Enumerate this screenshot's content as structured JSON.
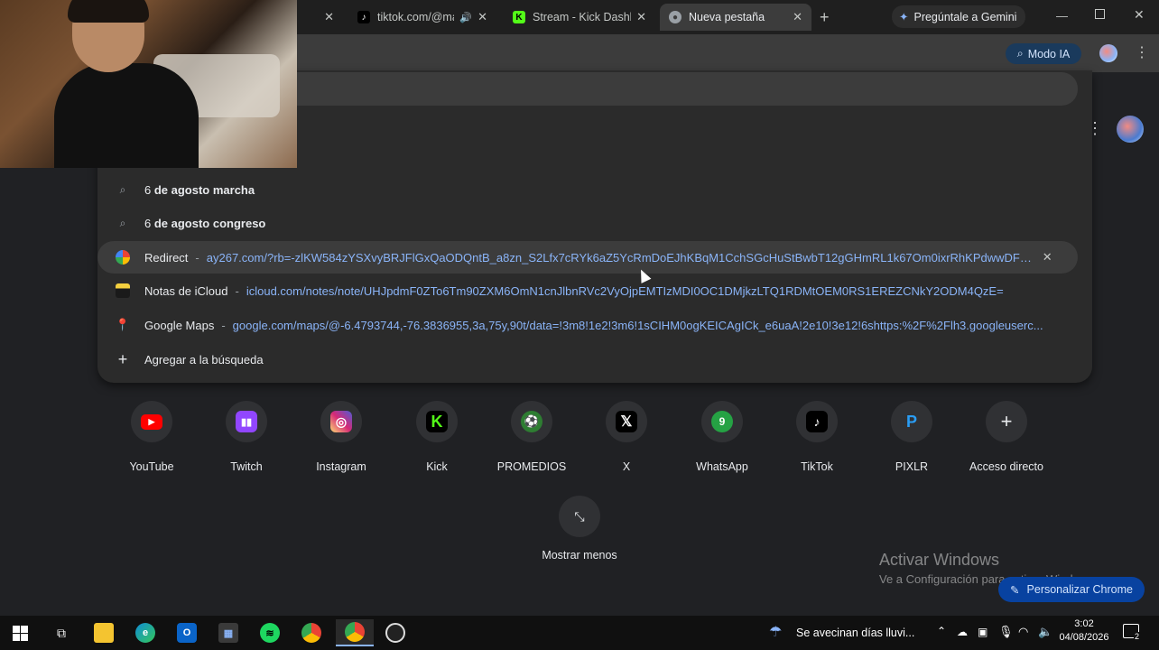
{
  "tabs": [
    {
      "title": "",
      "favicon": "none"
    },
    {
      "title": "tiktok.com/@mar",
      "favicon": "tiktok-icon"
    },
    {
      "title": "Stream - Kick Dashbo",
      "favicon": "kick-icon"
    },
    {
      "title": "Nueva pestaña",
      "favicon": "chrome-icon"
    }
  ],
  "gemini_button": "Pregúntale a Gemini",
  "modo_ia": "Modo IA",
  "suggestions": [
    {
      "icon": "search-icon",
      "text_pre": "6 ",
      "text_bold": "de agosto marcha"
    },
    {
      "icon": "search-icon",
      "text_pre": "6 ",
      "text_bold": "de agosto congreso"
    },
    {
      "icon": "google-icon",
      "title": "Redirect",
      "url": "ay267.com/?rb=-zlKW584zYSXvyBRJFlGxQaODQntB_a8zn_S2Lfx7cRYk6aZ5YcRmDoEJhKBqM1CchSGcHuStBwbT12gGHmRL1k67Om0ixrRhKPdwwDFTS7M..."
    },
    {
      "icon": "icloud-notes-icon",
      "title": "Notas de iCloud",
      "url": "icloud.com/notes/note/UHJpdmF0ZTo6Tm90ZXM6OmN1cnJlbnRVc2VyOjpEMTIzMDI0OC1DMjkzLTQ1RDMtOEM0RS1EREZCNkY2ODM4QzE="
    },
    {
      "icon": "maps-pin-icon",
      "title": "Google Maps",
      "url": "google.com/maps/@-6.4793744,-76.3836955,3a,75y,90t/data=!3m8!1e2!3m6!1sCIHM0ogKEICAgICk_e6uaA!2e10!3e12!6shttps:%2F%2Flh3.googleuserc..."
    },
    {
      "icon": "plus-icon",
      "title": "Agregar a la búsqueda"
    }
  ],
  "shortcuts": [
    {
      "label": "YouTube",
      "icon": "youtube-icon",
      "color": "#ff0000"
    },
    {
      "label": "Twitch",
      "icon": "twitch-icon",
      "color": "#9146ff"
    },
    {
      "label": "Instagram",
      "icon": "instagram-icon",
      "color": "#d62976"
    },
    {
      "label": "Kick",
      "icon": "kick-icon",
      "color": "#53fc18"
    },
    {
      "label": "PROMEDIOS",
      "icon": "promedios-icon",
      "color": "#2e7d32"
    },
    {
      "label": "X",
      "icon": "x-icon",
      "color": "#000000"
    },
    {
      "label": "WhatsApp",
      "icon": "whatsapp-icon",
      "color": "#25d366"
    },
    {
      "label": "TikTok",
      "icon": "tiktok-icon",
      "color": "#000000"
    },
    {
      "label": "PIXLR",
      "icon": "pixlr-icon",
      "color": "#2a9df4"
    },
    {
      "label": "Acceso directo",
      "icon": "plus-icon",
      "color": "#303134"
    }
  ],
  "show_less": "Mostrar menos",
  "activate_windows_title": "Activar Windows",
  "activate_windows_sub": "Ve a Configuración para activar Windows.",
  "customize_chrome": "Personalizar Chrome",
  "taskbar": {
    "weather": "Se avecinan días lluvi...",
    "time": "3:02",
    "date": "04/08/2026",
    "notification_count": "2"
  }
}
